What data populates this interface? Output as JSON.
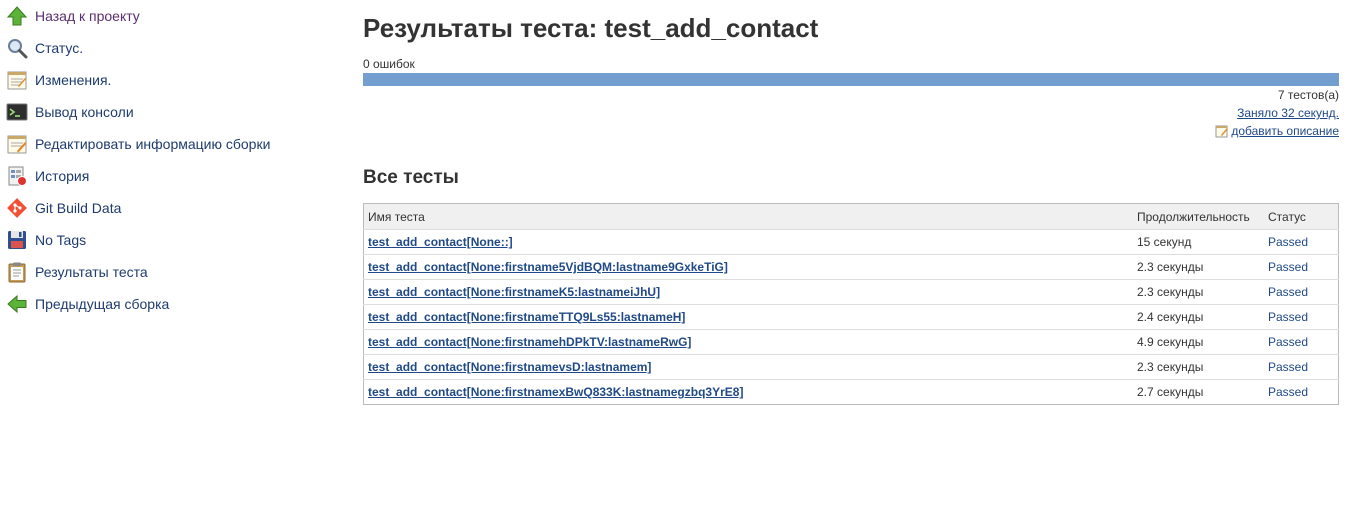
{
  "sidebar": {
    "items": [
      {
        "label": "Назад к проекту",
        "icon": "up-arrow-icon"
      },
      {
        "label": "Статус.",
        "icon": "search-icon"
      },
      {
        "label": "Изменения.",
        "icon": "notepad-icon"
      },
      {
        "label": "Вывод консоли",
        "icon": "terminal-icon"
      },
      {
        "label": "Редактировать информацию сборки",
        "icon": "notepad-edit-icon"
      },
      {
        "label": "История",
        "icon": "history-icon"
      },
      {
        "label": "Git Build Data",
        "icon": "git-icon"
      },
      {
        "label": "No Tags",
        "icon": "floppy-disk-icon"
      },
      {
        "label": "Результаты теста",
        "icon": "clipboard-icon"
      },
      {
        "label": "Предыдущая сборка",
        "icon": "left-arrow-icon"
      }
    ]
  },
  "main": {
    "title": "Результаты теста: test_add_contact",
    "failures": "0 ошибок",
    "pass_fraction": 1.0,
    "test_count": "7 тестов(а)",
    "duration": "Заняло 32 секунд.",
    "add_description": "добавить описание",
    "section_title": "Все тесты",
    "table": {
      "headers": {
        "name": "Имя теста",
        "duration": "Продолжительность",
        "status": "Статус"
      },
      "rows": [
        {
          "name": "test_add_contact[None::]",
          "duration": "15 секунд",
          "status": "Passed"
        },
        {
          "name": "test_add_contact[None:firstname5VjdBQM:lastname9GxkeTiG]",
          "duration": "2.3 секунды",
          "status": "Passed"
        },
        {
          "name": "test_add_contact[None:firstnameK5:lastnameiJhU]",
          "duration": "2.3 секунды",
          "status": "Passed"
        },
        {
          "name": "test_add_contact[None:firstnameTTQ9Ls55:lastnameH]",
          "duration": "2.4 секунды",
          "status": "Passed"
        },
        {
          "name": "test_add_contact[None:firstnamehDPkTV:lastnameRwG]",
          "duration": "4.9 секунды",
          "status": "Passed"
        },
        {
          "name": "test_add_contact[None:firstnamevsD:lastnamem]",
          "duration": "2.3 секунды",
          "status": "Passed"
        },
        {
          "name": "test_add_contact[None:firstnamexBwQ833K:lastnamegzbq3YrE8]",
          "duration": "2.7 секунды",
          "status": "Passed"
        }
      ]
    }
  },
  "colors": {
    "link": "#204a87",
    "progress_pass": "#729fcf",
    "header_bg": "#f0f0f0"
  }
}
